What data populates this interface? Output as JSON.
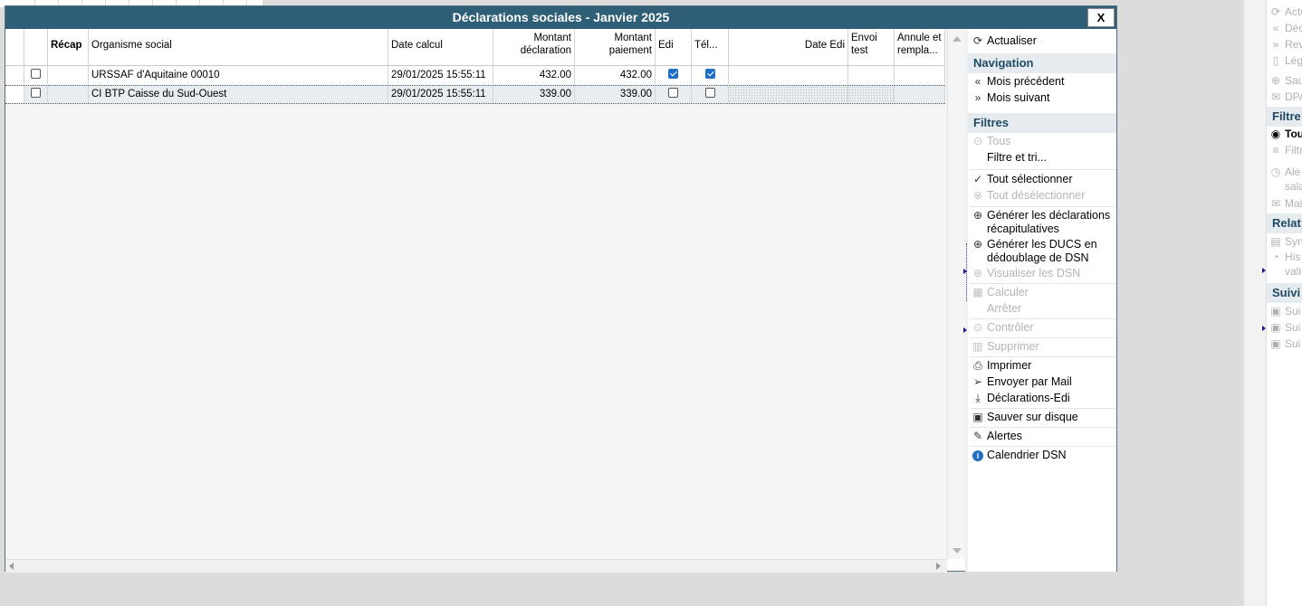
{
  "window": {
    "title": "Déclarations sociales - Janvier 2025",
    "close_label": "X"
  },
  "table": {
    "headers": {
      "recap": "Récap",
      "organisme": "Organisme social",
      "date_calcul": "Date calcul",
      "montant_declaration": "Montant déclaration",
      "montant_paiement": "Montant paiement",
      "edi": "Edi",
      "tel": "Tél...",
      "date_edi": "Date Edi",
      "envoi_test": "Envoi test",
      "annule": "Annule et rempla..."
    },
    "rows": [
      {
        "organisme": "URSSAF d'Aquitaine 00010",
        "date_calcul": "29/01/2025 15:55:11",
        "montant_declaration": "432.00",
        "montant_paiement": "432.00",
        "edi": true,
        "tel": true
      },
      {
        "organisme": "CI BTP Caisse du Sud-Ouest",
        "date_calcul": "29/01/2025 15:55:11",
        "montant_declaration": "339.00",
        "montant_paiement": "339.00",
        "edi": false,
        "tel": false
      }
    ]
  },
  "actions": {
    "actualiser": "Actualiser",
    "navigation_head": "Navigation",
    "mois_precedent": "Mois précédent",
    "mois_suivant": "Mois suivant",
    "filtres_head": "Filtres",
    "tous": "Tous",
    "filtre_tri": "Filtre et tri...",
    "tout_selectionner": "Tout sélectionner",
    "tout_deselectionner": "Tout désélectionner",
    "generer_recap": "Générer les déclarations récapitulatives",
    "generer_ducs": "Générer les DUCS en dédoublage de DSN",
    "visualiser_dsn": "Visualiser les DSN",
    "calculer": "Calculer",
    "arreter": "Arrêter",
    "controler": "Contrôler",
    "supprimer": "Supprimer",
    "imprimer": "Imprimer",
    "envoyer_mail": "Envoyer par Mail",
    "declarations_edi": "Déclarations-Edi",
    "sauver_disque": "Sauver sur disque",
    "alertes": "Alertes",
    "calendrier_dsn": "Calendrier DSN"
  },
  "right_panel": {
    "items": [
      "Actu",
      "Déc",
      "Rev",
      "Lég",
      "Sau",
      "DPA",
      "Tou",
      "Filtr",
      "Ale",
      "sala",
      "Mai",
      "Syn",
      "His",
      "vali",
      "Sui",
      "Sui",
      "Sui"
    ],
    "heads": [
      "Filtre",
      "Relat",
      "Suivi"
    ]
  },
  "icons": {
    "refresh": "refresh-icon",
    "double_left": "double-chevron-left-icon",
    "double_right": "double-chevron-right-icon",
    "play_circle": "play-circle-icon",
    "check_circle": "check-circle-icon",
    "x_circle": "x-circle-icon",
    "plus_circle": "plus-circle-icon",
    "calculator": "calculator-icon",
    "trash": "trash-icon",
    "printer": "printer-icon",
    "send": "send-icon",
    "download": "download-icon",
    "save": "save-icon",
    "pencil": "pencil-icon",
    "info": "info-icon"
  },
  "colors": {
    "titlebar": "#2f5f76",
    "section_head_bg": "#e6ebef",
    "section_head_text": "#1f4a63",
    "checkbox_checked": "#1f6fc4"
  }
}
